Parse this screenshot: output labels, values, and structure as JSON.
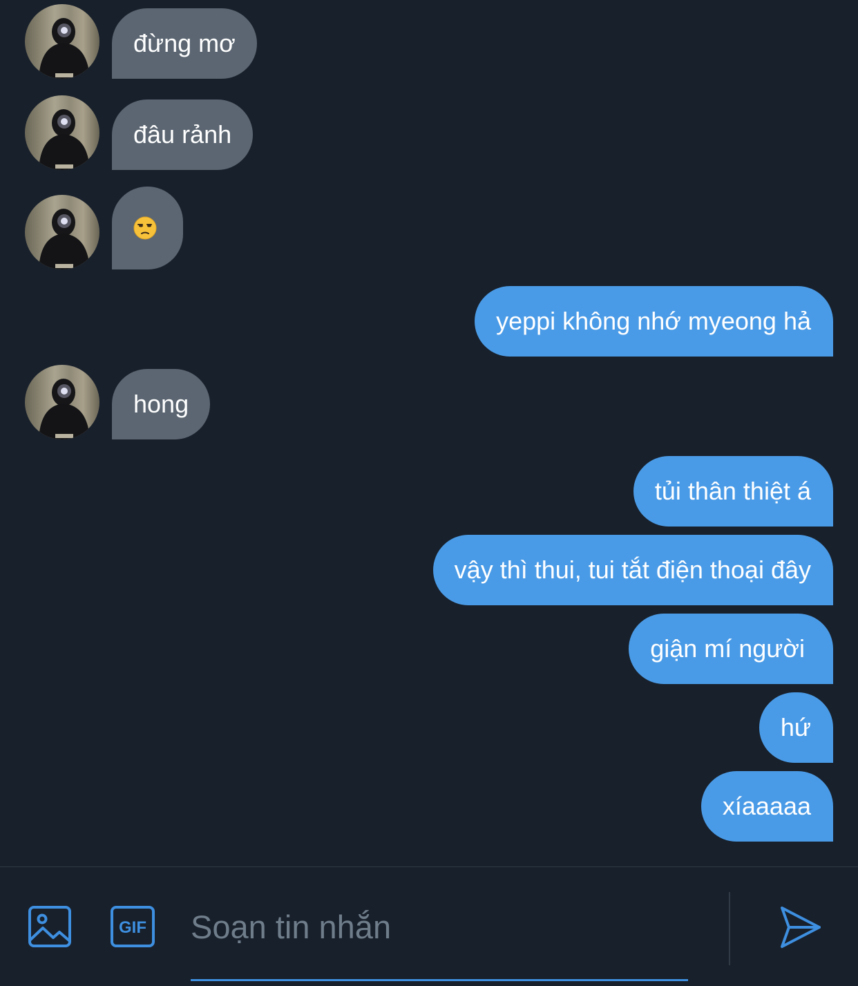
{
  "messages": [
    {
      "from": "them",
      "text": "đừng mơ"
    },
    {
      "from": "them",
      "text": "đâu rảnh"
    },
    {
      "from": "them",
      "text": "😒"
    },
    {
      "from": "me",
      "text": "yeppi không nhớ myeong hả"
    },
    {
      "from": "them",
      "text": "hong"
    },
    {
      "from": "me",
      "text": "tủi thân thiệt á"
    },
    {
      "from": "me",
      "text": "vậy thì thui, tui tắt điện thoại đây"
    },
    {
      "from": "me",
      "text": "giận mí người"
    },
    {
      "from": "me",
      "text": "hứ"
    },
    {
      "from": "me",
      "text": "xíaaaaa"
    }
  ],
  "composer": {
    "placeholder": "Soạn tin nhắn",
    "gif_label": "GIF",
    "image_icon": "image-icon",
    "send_icon": "send-icon"
  },
  "colors": {
    "background": "#18202b",
    "incoming_bubble": "#5b6672",
    "outgoing_bubble": "#4a9be7",
    "accent": "#3e8fe0"
  }
}
